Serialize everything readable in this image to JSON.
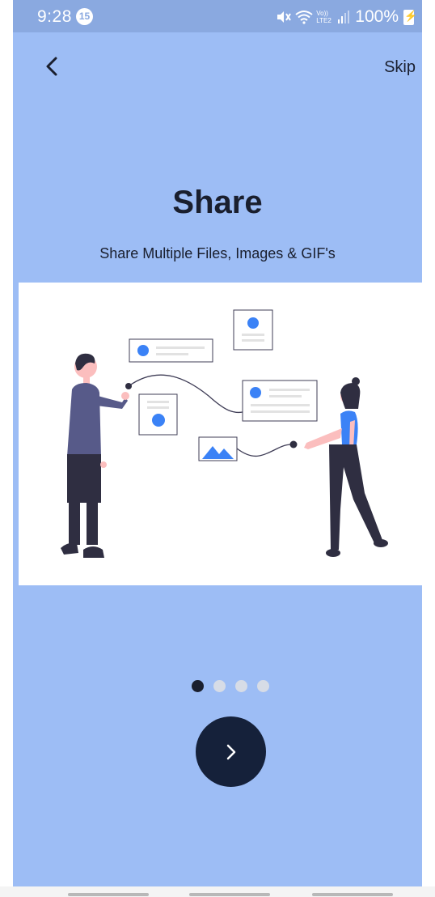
{
  "status_bar": {
    "time": "9:28",
    "notification_count": "15",
    "battery": "100%",
    "network_label": "Vo)) LTE2"
  },
  "header": {
    "skip_label": "Skip",
    "back_icon": "chevron-left-icon"
  },
  "onboarding": {
    "title": "Share",
    "subtitle": "Share Multiple Files, Images & GIF's",
    "page_count": 4,
    "active_page": 1
  },
  "next_button": {
    "icon": "chevron-right-icon"
  },
  "colors": {
    "background": "#9dbdf5",
    "status_bar": "#8aa9e0",
    "accent_blue": "#3b82f6",
    "dark_navy": "#15213a",
    "text_dark": "#1a1f2e"
  }
}
